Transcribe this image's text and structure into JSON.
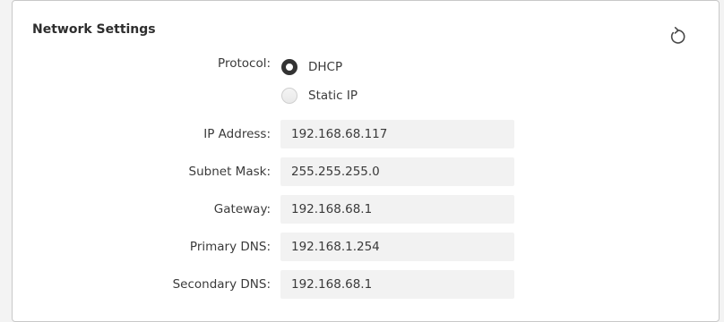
{
  "panel": {
    "title": "Network Settings",
    "reset_icon": "reset-icon"
  },
  "protocol": {
    "label": "Protocol:",
    "options": [
      {
        "label": "DHCP",
        "selected": true
      },
      {
        "label": "Static IP",
        "selected": false
      }
    ]
  },
  "fields": {
    "ip_address": {
      "label": "IP Address:",
      "value": "192.168.68.117"
    },
    "subnet_mask": {
      "label": "Subnet Mask:",
      "value": "255.255.255.0"
    },
    "gateway": {
      "label": "Gateway:",
      "value": "192.168.68.1"
    },
    "primary_dns": {
      "label": "Primary DNS:",
      "value": "192.168.1.254"
    },
    "secondary_dns": {
      "label": "Secondary DNS:",
      "value": "192.168.68.1"
    }
  },
  "colors": {
    "panel_background": "#ffffff",
    "page_background": "#f3f3f3",
    "field_background": "#f2f2f2",
    "text": "#3a3a3a",
    "selected_radio": "#333333"
  }
}
